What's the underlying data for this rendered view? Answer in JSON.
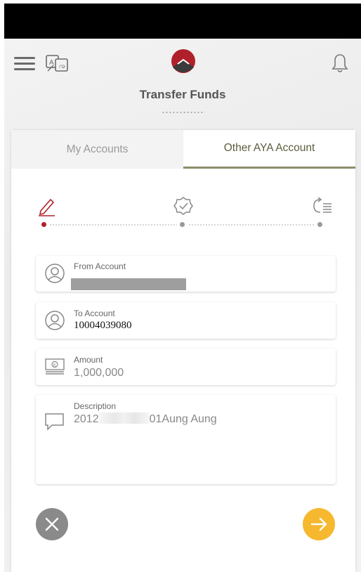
{
  "header": {
    "title": "Transfer Funds"
  },
  "tabs": [
    {
      "label": "My Accounts",
      "active": false
    },
    {
      "label": "Other AYA Account",
      "active": true
    }
  ],
  "stepper": {
    "steps": [
      "edit",
      "verify",
      "confirm"
    ],
    "current_step": 1
  },
  "form": {
    "from_account": {
      "label": "From Account",
      "value": ""
    },
    "to_account": {
      "label": "To Account",
      "value": "10004039080"
    },
    "amount": {
      "label": "Amount",
      "value": "1,000,000"
    },
    "description": {
      "label": "Description",
      "value_prefix": "2012",
      "value_suffix": "01Aung Aung"
    }
  },
  "icons": {
    "menu": "hamburger-menu-icon",
    "language": "language-toggle-icon",
    "notifications": "bell-icon",
    "step_edit": "pencil-icon",
    "step_verify": "badge-check-icon",
    "step_confirm": "list-arrow-icon",
    "account": "user-circle-icon",
    "amount": "cash-note-icon",
    "description": "chat-bubble-icon",
    "cancel": "close-icon",
    "next": "arrow-right-icon"
  },
  "colors": {
    "brand_red": "#b0202a",
    "active_tab_underline": "#8d8d6b",
    "next_button": "#f5b82e",
    "cancel_button": "#8a8a8a"
  }
}
